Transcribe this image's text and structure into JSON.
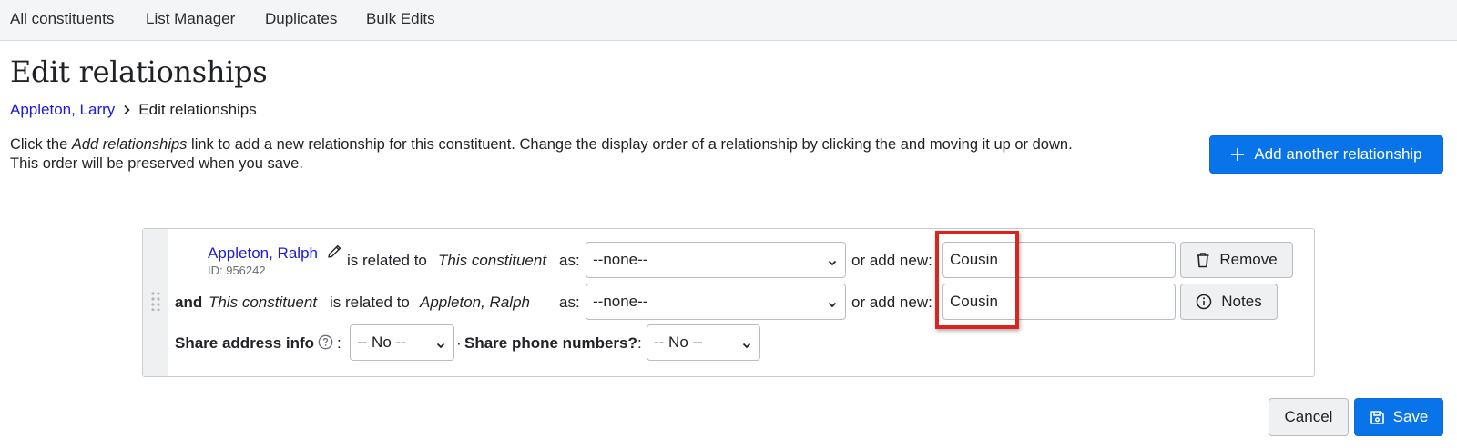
{
  "nav": {
    "items": [
      "All constituents",
      "List Manager",
      "Duplicates",
      "Bulk Edits"
    ]
  },
  "page": {
    "title": "Edit relationships"
  },
  "breadcrumb": {
    "parent": "Appleton, Larry",
    "current": "Edit relationships"
  },
  "instructions": {
    "pre": "Click the ",
    "link_italic": "Add relationships",
    "post1": " link to add a new relationship for this constituent. Change the display order of a relationship by clicking the and moving it up or down.",
    "line2": "This order will be preserved when you save."
  },
  "add_button": {
    "label": "Add another relationship"
  },
  "relationship": {
    "name": "Appleton, Ralph",
    "id_text": "ID: 956242",
    "row1": {
      "is_related_to": "is related to",
      "this_constituent": "This constituent",
      "as": "as:",
      "select_value": "--none--",
      "or_add_new": "or add new:",
      "input_value": "Cousin",
      "button_label": "Remove"
    },
    "row2": {
      "and": "and",
      "this_constituent": "This constituent",
      "is_related_to": "is related to",
      "target_name": "Appleton, Ralph",
      "as": "as:",
      "select_value": "--none--",
      "or_add_new": "or add new:",
      "input_value": "Cousin",
      "button_label": "Notes"
    },
    "row3": {
      "share_address_label": "Share address info",
      "colon": ":",
      "share_address_value": "-- No --",
      "separator": "·",
      "share_phone_label": "Share phone numbers?",
      "colon2": ":",
      "share_phone_value": "-- No --"
    }
  },
  "footer": {
    "cancel_label": "Cancel",
    "save_label": "Save"
  },
  "colors": {
    "primary": "#0974e9",
    "link": "#1b1bd9",
    "highlight": "#d8261f"
  }
}
